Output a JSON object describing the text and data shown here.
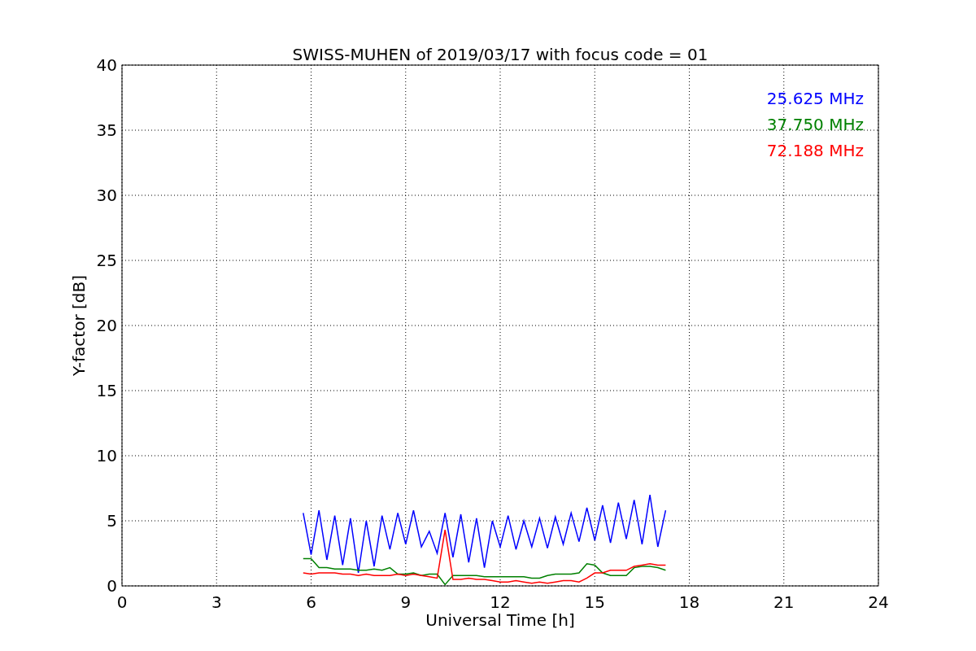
{
  "chart_data": {
    "type": "line",
    "title": "SWISS-MUHEN of 2019/03/17 with focus code = 01",
    "xlabel": "Universal Time [h]",
    "ylabel": "Y-factor [dB]",
    "grid": true,
    "xlim": [
      0,
      24
    ],
    "ylim": [
      0,
      40
    ],
    "xticks": [
      0,
      3,
      6,
      9,
      12,
      15,
      18,
      21,
      24
    ],
    "yticks": [
      0,
      5,
      10,
      15,
      20,
      25,
      30,
      35,
      40
    ],
    "x": [
      5.75,
      6,
      6.25,
      6.5,
      6.75,
      7,
      7.25,
      7.5,
      7.75,
      8,
      8.25,
      8.5,
      8.75,
      9,
      9.25,
      9.5,
      9.75,
      10,
      10.25,
      10.5,
      10.75,
      11,
      11.25,
      11.5,
      11.75,
      12,
      12.25,
      12.5,
      12.75,
      13,
      13.25,
      13.5,
      13.75,
      14,
      14.25,
      14.5,
      14.75,
      15,
      15.25,
      15.5,
      15.75,
      16,
      16.25,
      16.5,
      16.75,
      17,
      17.25
    ],
    "series": [
      {
        "name": "25.625 MHz",
        "color": "#0000ff",
        "values": [
          5.6,
          2.4,
          5.8,
          2.0,
          5.4,
          1.6,
          5.2,
          1.0,
          5.0,
          1.5,
          5.4,
          2.8,
          5.6,
          3.2,
          5.8,
          3.0,
          4.2,
          2.5,
          5.6,
          2.2,
          5.5,
          1.8,
          5.2,
          1.4,
          5.0,
          3.0,
          5.4,
          2.8,
          5.0,
          3.0,
          5.2,
          2.9,
          5.3,
          3.2,
          5.6,
          3.4,
          6.0,
          3.5,
          6.2,
          3.3,
          6.4,
          3.6,
          6.6,
          3.2,
          7.0,
          3.0,
          5.8
        ]
      },
      {
        "name": "37.750 MHz",
        "color": "#008000",
        "values": [
          2.1,
          2.1,
          1.4,
          1.4,
          1.3,
          1.3,
          1.3,
          1.2,
          1.2,
          1.3,
          1.2,
          1.4,
          0.9,
          0.9,
          1.0,
          0.8,
          0.9,
          0.9,
          0.1,
          0.8,
          0.8,
          0.8,
          0.8,
          0.7,
          0.7,
          0.7,
          0.7,
          0.7,
          0.7,
          0.6,
          0.6,
          0.8,
          0.9,
          0.9,
          0.9,
          1.0,
          1.7,
          1.6,
          1.0,
          0.8,
          0.8,
          0.8,
          1.4,
          1.5,
          1.5,
          1.4,
          1.2
        ]
      },
      {
        "name": "72.188 MHz",
        "color": "#ff0000",
        "values": [
          1.0,
          0.9,
          1.0,
          1.0,
          1.0,
          0.9,
          0.9,
          0.8,
          0.9,
          0.8,
          0.8,
          0.8,
          0.9,
          0.8,
          0.9,
          0.8,
          0.7,
          0.6,
          4.3,
          0.5,
          0.5,
          0.6,
          0.5,
          0.5,
          0.4,
          0.3,
          0.3,
          0.4,
          0.3,
          0.2,
          0.3,
          0.2,
          0.3,
          0.4,
          0.4,
          0.3,
          0.6,
          1.0,
          1.0,
          1.2,
          1.2,
          1.2,
          1.5,
          1.6,
          1.7,
          1.6,
          1.6
        ]
      }
    ]
  }
}
